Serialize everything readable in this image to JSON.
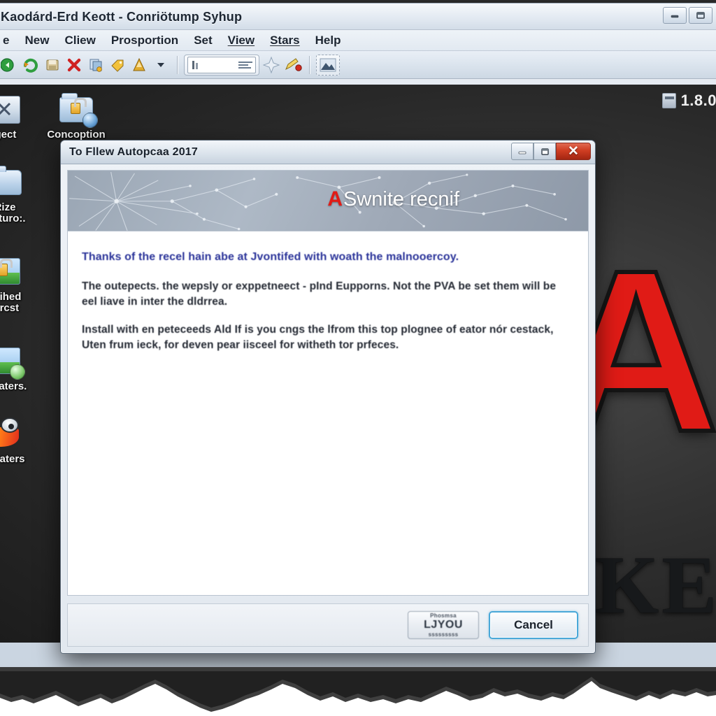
{
  "app": {
    "title": "Kaodárd-Erd Keott - Conriötump Syhup",
    "window_buttons": [
      {
        "name": "minimize",
        "glyph": "—"
      },
      {
        "name": "restore",
        "glyph": "❐"
      }
    ],
    "menu": [
      {
        "label": "e",
        "underlined": false
      },
      {
        "label": "New",
        "underlined": false
      },
      {
        "label": "Cliew",
        "underlined": false
      },
      {
        "label": "Prosportion",
        "underlined": false
      },
      {
        "label": "Set",
        "underlined": false
      },
      {
        "label": "View",
        "underlined": true
      },
      {
        "label": "Stars",
        "underlined": true
      },
      {
        "label": "Help",
        "underlined": false
      }
    ],
    "toolbar": {
      "icons": [
        "back-green-icon",
        "refresh-green-icon",
        "save-icon",
        "delete-x-icon",
        "copy-page-icon",
        "tag-icon",
        "alert-cone-icon",
        "dropdown-caret-icon"
      ],
      "field_group": "properties-field",
      "star_icon": "star-icon",
      "pencil_icon": "pencil-record-icon",
      "image_icon": "image-icon"
    }
  },
  "desktop": {
    "version_badge": "1.8.0",
    "wallpaper": {
      "logo_letter": "A",
      "wordmark": "IKE",
      "accent": "#e01b16"
    },
    "icons": [
      {
        "label": "rgect",
        "glyph": "sq-icon"
      },
      {
        "label": "Concoption",
        "glyph": "folder-lock-icon"
      },
      {
        "label": "Rize\nMeturo:.",
        "glyph": "folder-icon"
      },
      {
        "label": "Ollihed\nHrrcst",
        "glyph": "picture-lock-icon"
      },
      {
        "label": "pinlaters.",
        "glyph": "picture-green-icon"
      },
      {
        "label": "Pigraters",
        "glyph": "mouse-flame-icon"
      }
    ]
  },
  "dialog": {
    "title": "To Fllew Autopcaa 2017",
    "window_buttons": [
      {
        "name": "minimize",
        "glyph": "—"
      },
      {
        "name": "restore",
        "glyph": "❐"
      },
      {
        "name": "close",
        "glyph": "✕"
      }
    ],
    "banner": {
      "brand_mark": "A",
      "brand_text": "Swnite recnif"
    },
    "content": {
      "heading": "Thanks of the recel hain abe at Jvontifed with woath the malnooercoy.",
      "paragraphs": [
        "The outepects. the wepsly or exppetneect - pInd Eupporns. Not the PVA be set them will be eel liave in inter the dldrrea.",
        "Install with en peteceeds Ald If is you cngs the lfrom this top plognee of eator nór cestack, Uten frum ieck, for deven pear iisceel for witheth tor prfeces."
      ]
    },
    "footer": {
      "secondary_button": {
        "micro_top": "Phosmsa",
        "label": "LJYOU",
        "micro_bottom": "sssssssss"
      },
      "primary_button": {
        "label": "Cancel"
      }
    }
  }
}
